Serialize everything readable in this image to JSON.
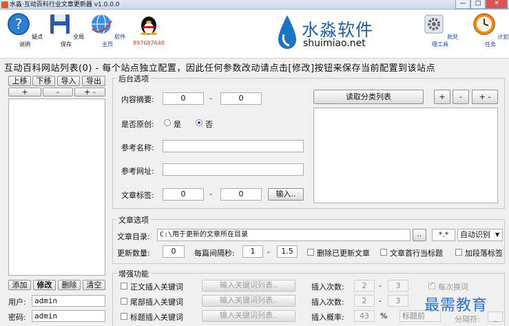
{
  "window": {
    "title": "水淼·互动百科行业文章更新器 v1.0.0.0",
    "min": "—",
    "max": "□",
    "close": "✕"
  },
  "toolbar": {
    "help_label": "疑点说明",
    "save_label": "全局保存",
    "home_label": "软件主页",
    "qq_label": "897687648",
    "batch_label": "批处理工具",
    "schedule_label": "计划任务"
  },
  "logo": {
    "title": "水淼软件",
    "subtitle": "shuimiao.net"
  },
  "site_list": {
    "header": "互动百科网站列表(0) - 每个站点独立配置，因此任何参数改动请点击[修改]按钮来保存当前配置到该站点",
    "up": "上移",
    "down": "下移",
    "import": "导入",
    "export": "导出",
    "plus": "+",
    "minus": "-",
    "plusminus": "+ -",
    "add": "添加",
    "edit": "修改",
    "delete": "删除",
    "clear": "清空",
    "user_label": "用户:",
    "user_value": "admin",
    "pass_label": "密码:",
    "pass_value": "admin"
  },
  "backend": {
    "title": "后台选项",
    "summary_label": "内容摘要:",
    "summary_from": "0",
    "dash": "-",
    "summary_to": "0",
    "original_label": "是否原创:",
    "yes": "是",
    "no": "否",
    "ref_name_label": "参考名称:",
    "ref_name_value": "",
    "ref_url_label": "参考网址:",
    "ref_url_value": "",
    "tag_label": "文章标签:",
    "tag_from": "0",
    "tag_to": "0",
    "input_btn": "输入..",
    "read_category_btn": "读取分类列表",
    "cat_plus": "+",
    "cat_minus": "-",
    "cat_plusminus": "+ -"
  },
  "article": {
    "title": "文章选项",
    "dir_label": "文章目录:",
    "dir_value": "C:\\用于更新的文章所在目录",
    "browse": "..",
    "ext_value": "*.*",
    "encoding_value": "自动识别",
    "encoding_arrow": "▼",
    "count_label": "更新数量:",
    "count_value": "0",
    "interval_label": "每篇间隔秒:",
    "interval_from": "1",
    "dash": "-",
    "interval_to": "1.5",
    "delete_updated": "删除已更新文章",
    "first_line_title": "文章首行当标题",
    "add_para_tags": "加段落标签"
  },
  "enhance": {
    "title": "增强功能",
    "body_insert": "正文插入关键词",
    "tail_insert": "尾部插入关键词",
    "title_insert": "标题插入关键词",
    "input_kw_btn": "输入关键词列表..",
    "insert_count_label": "插入次数:",
    "insert_prob_label": "插入概率:",
    "count1_from": "2",
    "count1_to": "3",
    "count2_from": "2",
    "count2_to": "3",
    "prob_value": "43",
    "percent": "%",
    "position_value": "标题前",
    "every_change": "每次换词",
    "separator_label": "分隔符:",
    "separator_value": "_"
  },
  "watermark": "最需教育"
}
